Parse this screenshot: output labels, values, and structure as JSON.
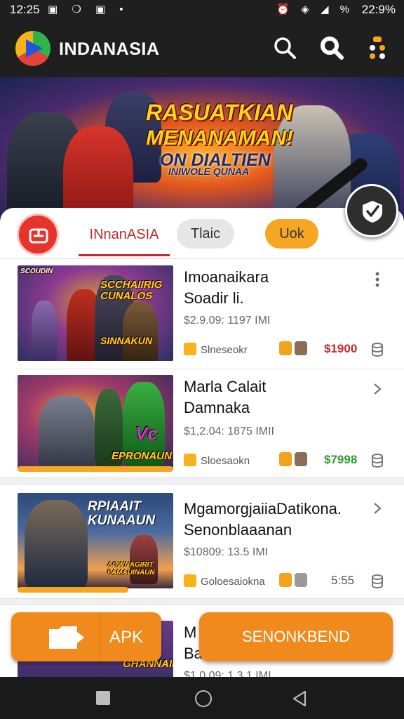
{
  "status_bar": {
    "time_left": "12:25",
    "left_icons": "▣ ❍ ▣ •",
    "right_icons": "⏰ ◈ ◢ %",
    "time_right": "22:9%"
  },
  "app_bar": {
    "title": "INDANASIA",
    "icons": [
      "search-icon",
      "search-filled-icon",
      "menu-icon"
    ]
  },
  "banner": {
    "line1": "RASUATKIAN",
    "line2": "MENANAMAN!",
    "line3": "ON DIALTIEN",
    "line4": "INIWOLE QUNAA"
  },
  "tabs": {
    "active": "INnanASIA",
    "tab2": "Tlaic",
    "tab3": "Uok"
  },
  "games": [
    {
      "thumb_top": "SCOUDIN",
      "thumb_main": "SCCHAIIRIG CUNALOS",
      "thumb_bottom": "SINNAKUN",
      "name_line1": "Imoanaikara",
      "name_line2": "Soadir li.",
      "meta": "$2.9.09: 1197 IMI",
      "category": "Slneseokr",
      "price": "$1900",
      "price_color": "#c62828",
      "action_icon": "more-vertical-icon"
    },
    {
      "thumb_main": "Vc",
      "thumb_bottom": "EPRONAUN",
      "name_line1": "Marla Calait",
      "name_line2": "Damnaka",
      "meta": "$1,2.04: 1875 IMII",
      "category": "Sloesaokn",
      "price": "$7998",
      "price_color": "#2e9b2e",
      "action_icon": "chevron-right-icon"
    },
    {
      "thumb_main": "RPIAAIT KUNAAUN",
      "thumb_bottom": "AOWNAGIRIT PAMAUINAUN",
      "name_line1": "MgamorgjaiiaDatikona.",
      "name_line2": "Senonblaaanan",
      "meta": "$10809: 13.5 IMI",
      "category": "Goloesaiokna",
      "price": "5:55",
      "price_color": "#555555",
      "action_icon": "chevron-right-icon"
    },
    {
      "thumb_main": "GHANNAIN",
      "name_line1": "M",
      "name_line2": "Ba",
      "meta": "$1.0.09: 1.3.1 IMI"
    }
  ],
  "buttons": {
    "apk": "APK",
    "download": "SENONKBEND"
  },
  "colors": {
    "accent_orange": "#f08a1c",
    "accent_red": "#c1272d",
    "bar_dark": "#1f1f1f"
  }
}
